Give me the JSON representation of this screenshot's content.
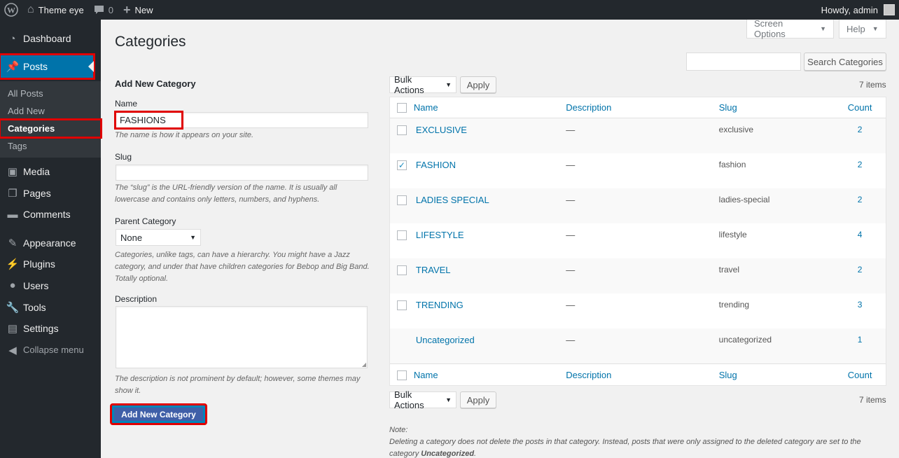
{
  "adminbar": {
    "site_name": "Theme eye",
    "comments_count": "0",
    "new_label": "New",
    "greeting": "Howdy, admin"
  },
  "sidebar": {
    "items": [
      {
        "label": "Dashboard",
        "icon": "dashboard-icon"
      },
      {
        "label": "Posts",
        "icon": "pin-icon"
      },
      {
        "label": "Media",
        "icon": "media-icon"
      },
      {
        "label": "Pages",
        "icon": "pages-icon"
      },
      {
        "label": "Comments",
        "icon": "comments-icon"
      },
      {
        "label": "Appearance",
        "icon": "brush-icon"
      },
      {
        "label": "Plugins",
        "icon": "plugin-icon"
      },
      {
        "label": "Users",
        "icon": "user-icon"
      },
      {
        "label": "Tools",
        "icon": "wrench-icon"
      },
      {
        "label": "Settings",
        "icon": "settings-icon"
      }
    ],
    "submenu": [
      "All Posts",
      "Add New",
      "Categories",
      "Tags"
    ],
    "collapse_label": "Collapse menu"
  },
  "header": {
    "title": "Categories",
    "screen_options": "Screen Options",
    "help": "Help",
    "search_button": "Search Categories",
    "search_value": ""
  },
  "form": {
    "heading": "Add New Category",
    "name_label": "Name",
    "name_value": "FASHIONS",
    "name_hint": "The name is how it appears on your site.",
    "slug_label": "Slug",
    "slug_value": "",
    "slug_hint": "The “slug” is the URL-friendly version of the name. It is usually all lowercase and contains only letters, numbers, and hyphens.",
    "parent_label": "Parent Category",
    "parent_value": "None",
    "parent_hint": "Categories, unlike tags, can have a hierarchy. You might have a Jazz category, and under that have children categories for Bebop and Big Band. Totally optional.",
    "description_label": "Description",
    "description_hint": "The description is not prominent by default; however, some themes may show it.",
    "submit_label": "Add New Category"
  },
  "table": {
    "bulk_actions": "Bulk Actions",
    "apply": "Apply",
    "items_count": "7 items",
    "columns": [
      "Name",
      "Description",
      "Slug",
      "Count"
    ],
    "rows": [
      {
        "name": "EXCLUSIVE",
        "description": "—",
        "slug": "exclusive",
        "count": "2",
        "checked": false
      },
      {
        "name": "FASHION",
        "description": "—",
        "slug": "fashion",
        "count": "2",
        "checked": true
      },
      {
        "name": "LADIES SPECIAL",
        "description": "—",
        "slug": "ladies-special",
        "count": "2",
        "checked": false
      },
      {
        "name": "LIFESTYLE",
        "description": "—",
        "slug": "lifestyle",
        "count": "4",
        "checked": false
      },
      {
        "name": "TRAVEL",
        "description": "—",
        "slug": "travel",
        "count": "2",
        "checked": false
      },
      {
        "name": "TRENDING",
        "description": "—",
        "slug": "trending",
        "count": "3",
        "checked": false
      },
      {
        "name": "Uncategorized",
        "description": "—",
        "slug": "uncategorized",
        "count": "1",
        "checked": null
      }
    ]
  },
  "note": {
    "title": "Note:",
    "text_before": "Deleting a category does not delete the posts in that category. Instead, posts that were only assigned to the deleted category are set to the category ",
    "emphasis": "Uncategorized",
    "text_after": "."
  },
  "colors": {
    "adminbar_bg": "#23282d",
    "accent": "#0073aa",
    "highlight": "#e00000"
  }
}
